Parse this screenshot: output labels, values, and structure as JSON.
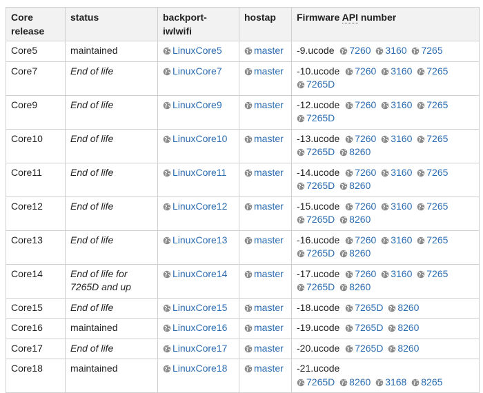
{
  "table": {
    "headers": {
      "core": "Core release",
      "status": "status",
      "backport": "backport-iwlwifi",
      "hostap": "hostap",
      "firmware_pre": "Firmware ",
      "firmware_abbr": "API",
      "firmware_post": " number"
    },
    "link_color": "#2a6bb0",
    "icon": "globe-icon",
    "rows": [
      {
        "core": "Core5",
        "status": "maintained",
        "status_style": "normal",
        "backport": "LinuxCore5",
        "hostap": "master",
        "ucode": "-9.ucode",
        "firmware": [
          "7260",
          "3160",
          "7265"
        ]
      },
      {
        "core": "Core7",
        "status": "End of life",
        "status_style": "italic",
        "backport": "LinuxCore7",
        "hostap": "master",
        "ucode": "-10.ucode",
        "firmware": [
          "7260",
          "3160",
          "7265",
          "7265D"
        ]
      },
      {
        "core": "Core9",
        "status": "End of life",
        "status_style": "italic",
        "backport": "LinuxCore9",
        "hostap": "master",
        "ucode": "-12.ucode",
        "firmware": [
          "7260",
          "3160",
          "7265",
          "7265D"
        ]
      },
      {
        "core": "Core10",
        "status": "End of life",
        "status_style": "italic",
        "backport": "LinuxCore10",
        "hostap": "master",
        "ucode": "-13.ucode",
        "firmware": [
          "7260",
          "3160",
          "7265",
          "7265D",
          "8260"
        ]
      },
      {
        "core": "Core11",
        "status": "End of life",
        "status_style": "italic",
        "backport": "LinuxCore11",
        "hostap": "master",
        "ucode": "-14.ucode",
        "firmware": [
          "7260",
          "3160",
          "7265",
          "7265D",
          "8260"
        ]
      },
      {
        "core": "Core12",
        "status": "End of life",
        "status_style": "italic",
        "backport": "LinuxCore12",
        "hostap": "master",
        "ucode": "-15.ucode",
        "firmware": [
          "7260",
          "3160",
          "7265",
          "7265D",
          "8260"
        ]
      },
      {
        "core": "Core13",
        "status": "End of life",
        "status_style": "italic",
        "backport": "LinuxCore13",
        "hostap": "master",
        "ucode": "-16.ucode",
        "firmware": [
          "7260",
          "3160",
          "7265",
          "7265D",
          "8260"
        ]
      },
      {
        "core": "Core14",
        "status": "End of life for 7265D and up",
        "status_style": "italic",
        "backport": "LinuxCore14",
        "hostap": "master",
        "ucode": "-17.ucode",
        "firmware": [
          "7260",
          "3160",
          "7265",
          "7265D",
          "8260"
        ]
      },
      {
        "core": "Core15",
        "status": "End of life",
        "status_style": "italic",
        "backport": "LinuxCore15",
        "hostap": "master",
        "ucode": "-18.ucode",
        "firmware": [
          "7265D",
          "8260"
        ]
      },
      {
        "core": "Core16",
        "status": "maintained",
        "status_style": "normal",
        "backport": "LinuxCore16",
        "hostap": "master",
        "ucode": "-19.ucode",
        "firmware": [
          "7265D",
          "8260"
        ]
      },
      {
        "core": "Core17",
        "status": "End of life",
        "status_style": "italic",
        "backport": "LinuxCore17",
        "hostap": "master",
        "ucode": "-20.ucode",
        "firmware": [
          "7265D",
          "8260"
        ]
      },
      {
        "core": "Core18",
        "status": "maintained",
        "status_style": "normal",
        "backport": "LinuxCore18",
        "hostap": "master",
        "ucode": "-21.ucode",
        "firmware": [
          "7265D",
          "8260",
          "3168",
          "8265"
        ],
        "ucode_break": true
      }
    ]
  }
}
